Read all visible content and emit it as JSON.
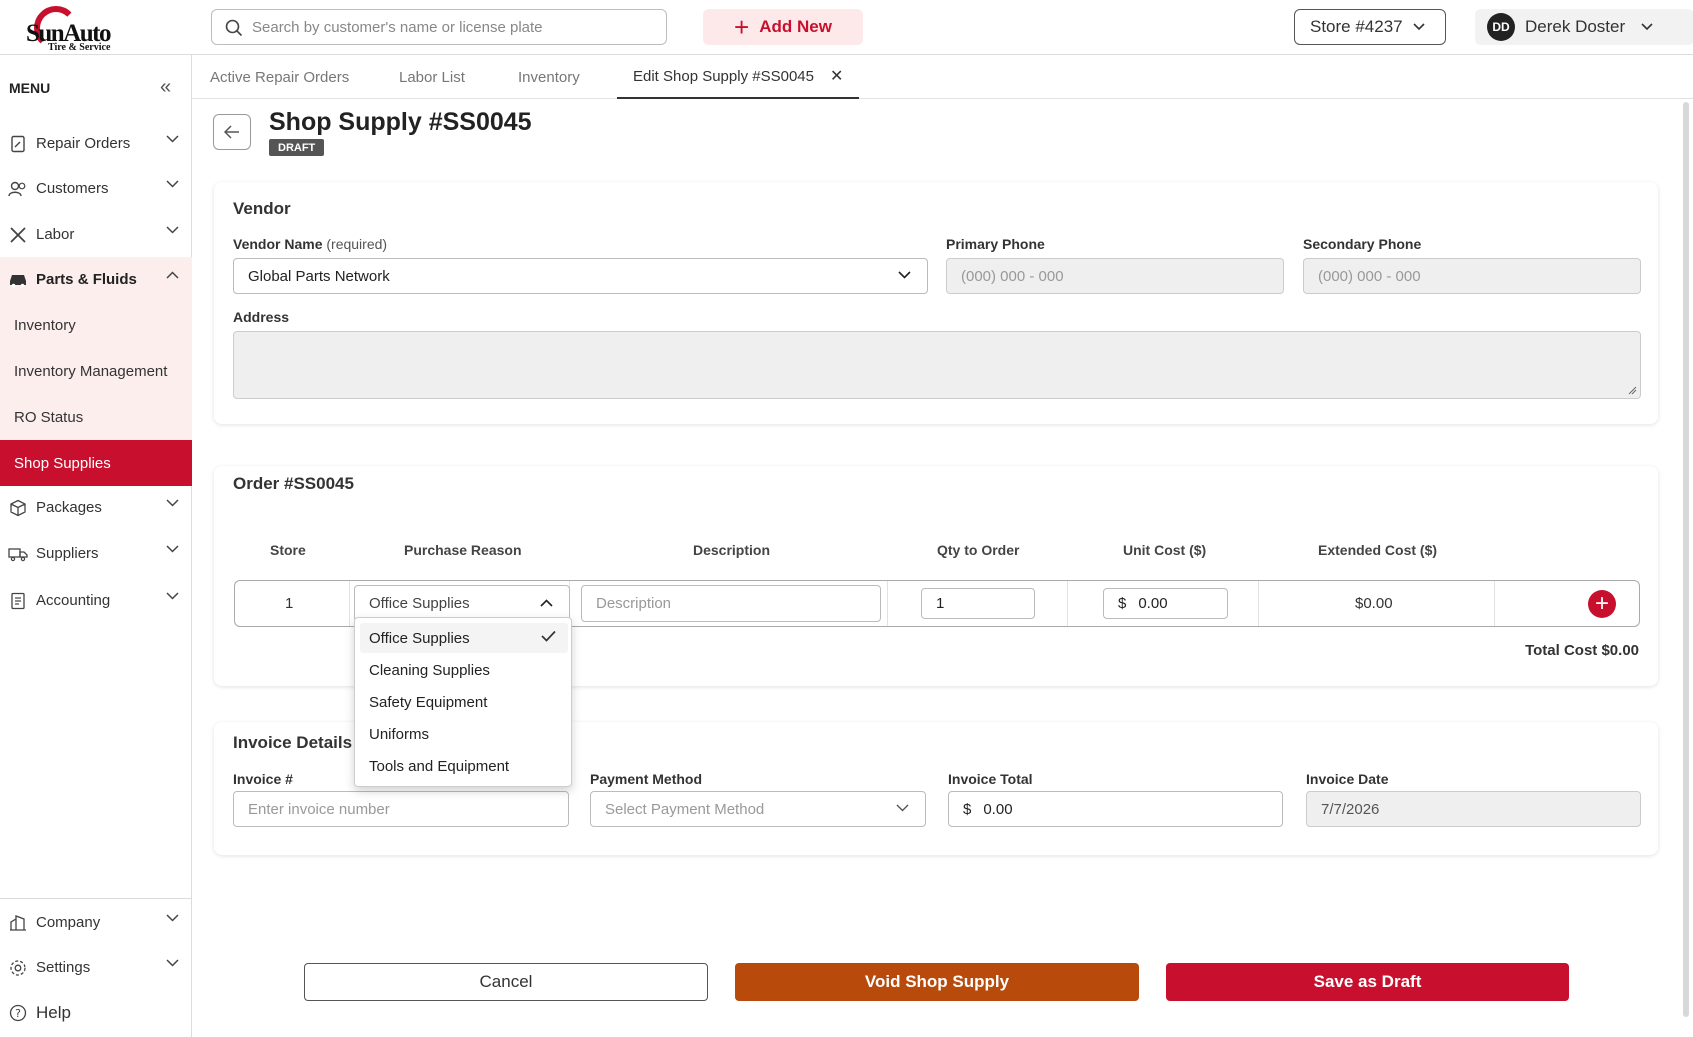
{
  "header": {
    "logo_brand": "SunAuto",
    "logo_sub": "Tire & Service",
    "search_placeholder": "Search by customer's name or license plate",
    "add_new_label": "Add New",
    "store_label": "Store #4237",
    "user_initials": "DD",
    "user_name": "Derek Doster"
  },
  "sidebar": {
    "menu_label": "MENU",
    "items": [
      {
        "label": "Repair Orders",
        "icon": "document-edit-icon"
      },
      {
        "label": "Customers",
        "icon": "users-icon"
      },
      {
        "label": "Labor",
        "icon": "tools-icon"
      },
      {
        "label": "Parts & Fluids",
        "icon": "car-icon"
      },
      {
        "label": "Packages",
        "icon": "box-icon"
      },
      {
        "label": "Suppliers",
        "icon": "truck-icon"
      },
      {
        "label": "Accounting",
        "icon": "ledger-icon"
      },
      {
        "label": "Company",
        "icon": "building-icon"
      },
      {
        "label": "Settings",
        "icon": "gear-icon"
      },
      {
        "label": "Help",
        "icon": "help-icon"
      }
    ],
    "sub_items": [
      "Inventory",
      "Inventory Management",
      "RO Status",
      "Shop Supplies"
    ]
  },
  "tabs": [
    "Active Repair Orders",
    "Labor List",
    "Inventory",
    "Edit Shop Supply #SS0045"
  ],
  "page": {
    "title": "Shop Supply #SS0045",
    "status": "DRAFT"
  },
  "vendor": {
    "section_title": "Vendor",
    "name_label": "Vendor Name",
    "name_required": "(required)",
    "name_value": "Global Parts Network",
    "primary_phone_label": "Primary Phone",
    "primary_phone_placeholder": "(000) 000 - 000",
    "secondary_phone_label": "Secondary Phone",
    "secondary_phone_placeholder": "(000) 000 - 000",
    "address_label": "Address"
  },
  "order": {
    "section_title": "Order #SS0045",
    "columns": [
      "Store",
      "Purchase Reason",
      "Description",
      "Qty to Order",
      "Unit Cost ($)",
      "Extended Cost ($)"
    ],
    "row": {
      "store": "1",
      "purchase_reason": "Office Supplies",
      "description_placeholder": "Description",
      "qty": "1",
      "currency": "$",
      "unit_cost": "0.00",
      "extended_cost": "$0.00"
    },
    "total_label": "Total Cost $0.00",
    "reason_options": [
      "Office Supplies",
      "Cleaning Supplies",
      "Safety Equipment",
      "Uniforms",
      "Tools and Equipment"
    ]
  },
  "invoice": {
    "section_title": "Invoice Details",
    "number_label": "Invoice #",
    "number_placeholder": "Enter invoice number",
    "payment_label": "Payment Method",
    "payment_placeholder": "Select Payment Method",
    "total_label": "Invoice Total",
    "currency": "$",
    "total_value": "0.00",
    "date_label": "Invoice Date",
    "date_value": "7/7/2026"
  },
  "actions": {
    "cancel": "Cancel",
    "void": "Void Shop Supply",
    "save": "Save as Draft"
  },
  "colors": {
    "brand_red": "#c8102e",
    "void_orange": "#b84a0b",
    "sidebar_open_bg": "#fdeeee"
  }
}
